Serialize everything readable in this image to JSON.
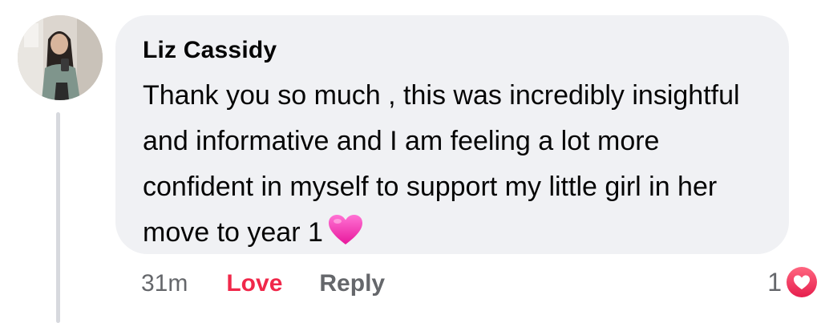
{
  "comment": {
    "author": "Liz Cassidy",
    "text": "Thank you so much , this was incredibly insightful and informative and I am feeling a lot more confident in myself to support my little girl in her move to year 1",
    "emoji": "pink-heart-icon",
    "timestamp": "31m",
    "love_label": "Love",
    "reply_label": "Reply",
    "reaction_count": "1",
    "reaction_icon": "love-reaction-icon"
  },
  "colors": {
    "bubble": "#f0f1f4",
    "love": "#f0284a",
    "meta": "#65676b",
    "thread_line": "#d7d9de"
  }
}
